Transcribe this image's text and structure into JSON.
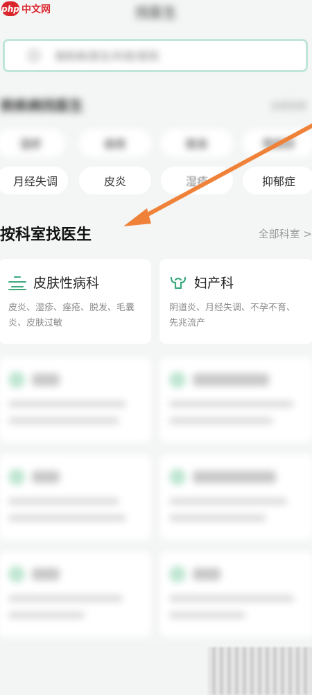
{
  "watermark": {
    "badge": "php",
    "text": "中文网"
  },
  "header": {
    "title": "找医生"
  },
  "search": {
    "placeholder": "搜疾病/医生/科室/医院"
  },
  "disease_section": {
    "title": "按疾病找医生",
    "more": "全部疾病",
    "pills_row1": [
      "湿疹",
      "痤疮",
      "脱发",
      "荨麻疹"
    ],
    "pills_row2": [
      "月经失调",
      "皮炎",
      "湿疹",
      "抑郁症"
    ]
  },
  "department_section": {
    "title": "按科室找医生",
    "more_label": "全部科室 >",
    "cards": [
      {
        "name": "皮肤性病科",
        "icon": "skin-icon",
        "desc": "皮炎、湿疹、痤疮、脱发、毛囊炎、皮肤过敏"
      },
      {
        "name": "妇产科",
        "icon": "gynecology-icon",
        "desc": "阴道炎、月经失调、不孕不育、先兆流产"
      }
    ]
  },
  "colors": {
    "accent": "#3aa87c",
    "arrow": "#ef8238",
    "search_border": "#bfe6d9"
  }
}
